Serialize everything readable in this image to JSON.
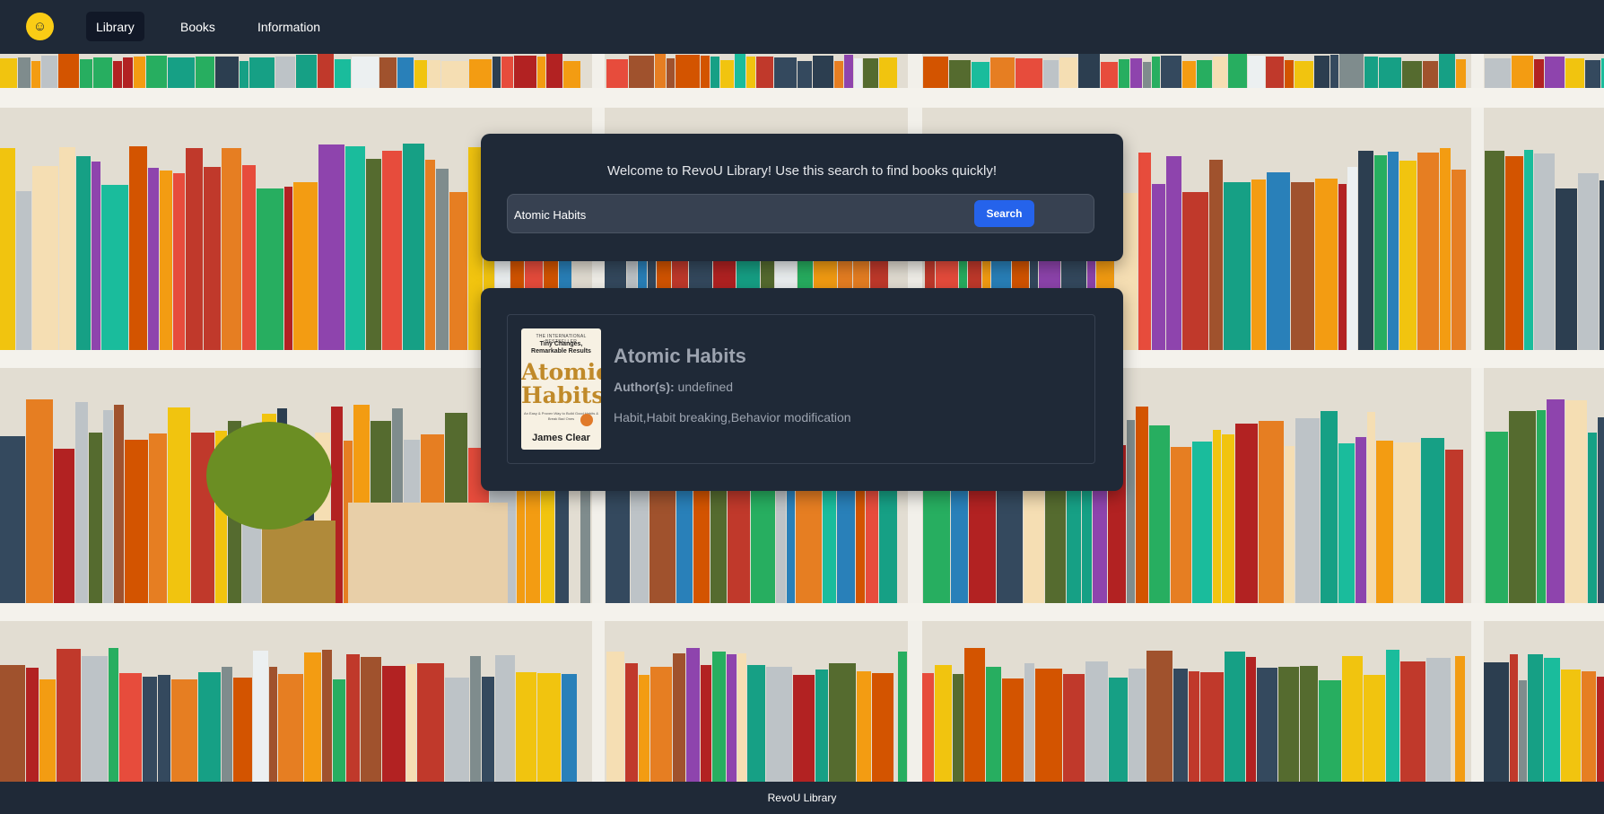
{
  "nav": {
    "logo_glyph": "☺",
    "items": [
      {
        "label": "Library",
        "active": true
      },
      {
        "label": "Books",
        "active": false
      },
      {
        "label": "Information",
        "active": false
      }
    ]
  },
  "search": {
    "welcome": "Welcome to RevoU Library! Use this search to find books quickly!",
    "value": "Atomic Habits",
    "button_label": "Search"
  },
  "result": {
    "title": "Atomic Habits",
    "author_label": "Author(s):",
    "author_value": "undefined",
    "subjects": "Habit,Habit breaking,Behavior modification",
    "cover": {
      "top_line": "THE INTERNATIONAL BESTSELLER",
      "subtitle": "Tiny Changes, Remarkable Results",
      "title_line1": "Atomic",
      "title_line2": "Habits",
      "small_text": "An Easy & Proven Way to Build Good Habits & Break Bad Ones",
      "author": "James Clear"
    }
  },
  "footer": {
    "text": "RevoU Library"
  },
  "colors": {
    "header_bg": "#1f2937",
    "card_bg": "#1f2937",
    "accent": "#2563eb",
    "logo": "#facc15"
  }
}
